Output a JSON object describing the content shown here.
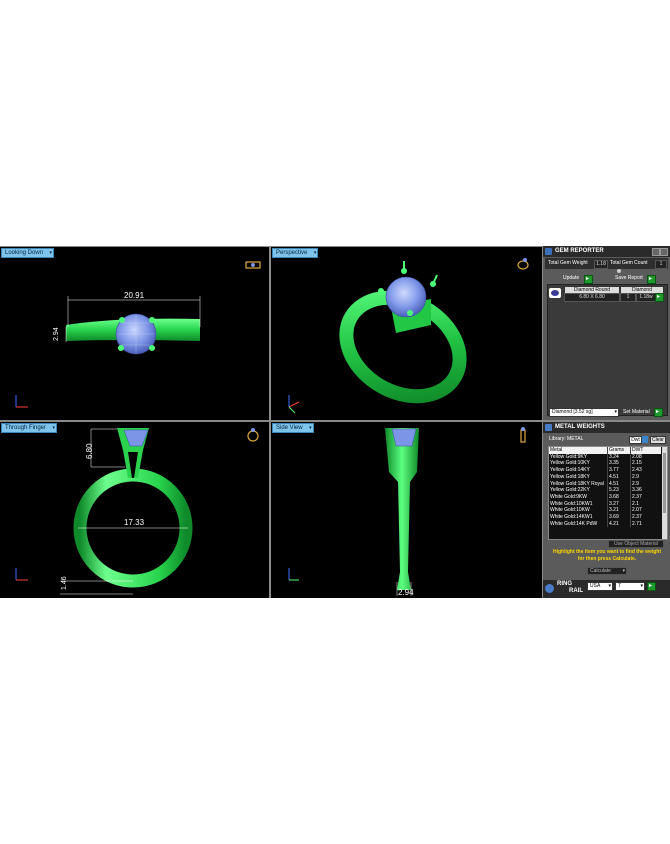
{
  "viewports": {
    "top_left": {
      "label": "Looking Down",
      "dim_width": "20.91",
      "dim_height": "2.94"
    },
    "top_right": {
      "label": "Perspective"
    },
    "bottom_left": {
      "label": "Through Finger",
      "dim_top": "6.80",
      "dim_inner": "17.33",
      "dim_bottom": "1.46"
    },
    "bottom_right": {
      "label": "Side View",
      "dim_bottom": "2.94"
    }
  },
  "gem_reporter": {
    "title": "GEM REPORTER",
    "total_weight_label": "Total Gem Weight",
    "total_weight_value": "1.18",
    "total_count_label": "Total Gem Count",
    "total_count_value": "1",
    "update_label": "Update",
    "save_label": "Save Report",
    "col_shape": "Diamond Round",
    "col_material": "Diamond",
    "row_size": "6.80 X 6.80",
    "row_count": "1",
    "row_weight": "1.18w",
    "material_select": "Diamond  [3.52 sg]",
    "set_material_label": "Set Material"
  },
  "metal_weights": {
    "title": "METAL WEIGHTS",
    "library_label": "Library: METAL",
    "units_label": "Dwt",
    "clear_label": "Clear",
    "headers": [
      "Metal",
      "Grams",
      "DWT"
    ],
    "rows": [
      [
        "Yellow Gold:9KY",
        "3.24",
        "2.08"
      ],
      [
        "Yellow Gold:10KY",
        "3.35",
        "2.15"
      ],
      [
        "Yellow Gold:14KY",
        "3.77",
        "2.43"
      ],
      [
        "Yellow Gold:18KY",
        "4.51",
        "2.9"
      ],
      [
        "Yellow Gold:18KY Royal",
        "4.51",
        "2.9"
      ],
      [
        "Yellow Gold:22KY",
        "5.23",
        "3.36"
      ],
      [
        "White Gold:9KW",
        "3.68",
        "2.37"
      ],
      [
        "White Gold:10KW1",
        "3.27",
        "2.1"
      ],
      [
        "White Gold:10KW",
        "3.21",
        "2.07"
      ],
      [
        "White Gold:14KW1",
        "3.69",
        "2.37"
      ],
      [
        "White Gold:14K PdW",
        "4.21",
        "2.71"
      ]
    ],
    "use_object_label": "Use Object Material",
    "instructions": "Highlight the item you want to find the weight for then press Calculate.",
    "calculate_label": "Calculate"
  },
  "ring_rail": {
    "title_line1": "RING",
    "title_line2": "RAIL",
    "region": "USA",
    "size": "7"
  }
}
